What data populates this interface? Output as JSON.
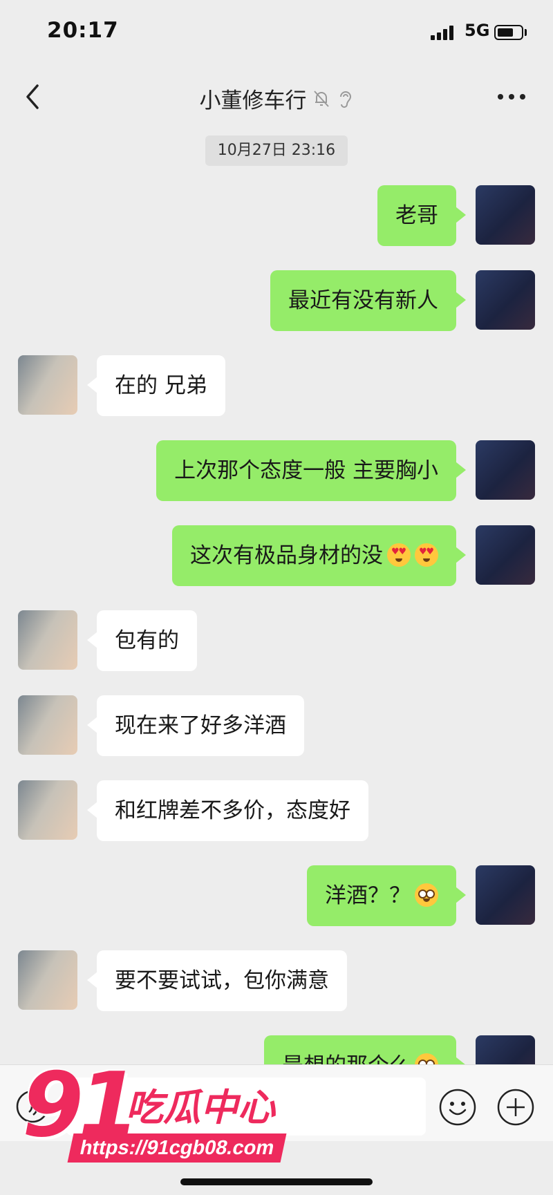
{
  "status_bar": {
    "time": "20:17",
    "network": "5G",
    "battery_level": 0.7
  },
  "nav": {
    "title": "小董修车行"
  },
  "timestamp": "10月27日 23:16",
  "messages": [
    {
      "sender": "me",
      "text": "老哥",
      "emoji": []
    },
    {
      "sender": "me",
      "text": "最近有没有新人",
      "emoji": []
    },
    {
      "sender": "other",
      "text": "在的 兄弟",
      "emoji": []
    },
    {
      "sender": "me",
      "text": "上次那个态度一般 主要胸小",
      "emoji": []
    },
    {
      "sender": "me",
      "text": "这次有极品身材的没",
      "emoji": [
        "heart-eyes-emoji",
        "heart-eyes-emoji"
      ]
    },
    {
      "sender": "other",
      "text": "包有的",
      "emoji": []
    },
    {
      "sender": "other",
      "text": "现在来了好多洋酒",
      "emoji": []
    },
    {
      "sender": "other",
      "text": "和红牌差不多价，态度好",
      "emoji": []
    },
    {
      "sender": "me",
      "text": "洋酒？？",
      "emoji": [
        "flushed-emoji"
      ]
    },
    {
      "sender": "other",
      "text": "要不要试试，包你满意",
      "emoji": []
    },
    {
      "sender": "me",
      "text": "是想的那个么",
      "emoji": [
        "flushed-emoji"
      ]
    }
  ],
  "input": {
    "placeholder": ""
  },
  "watermark": {
    "number": "91",
    "text": "吃瓜中心",
    "url": "https://91cgb08.com"
  },
  "colors": {
    "background": "#ededed",
    "my_bubble": "#95ec69",
    "their_bubble": "#ffffff",
    "watermark": "#ee2a5d"
  }
}
